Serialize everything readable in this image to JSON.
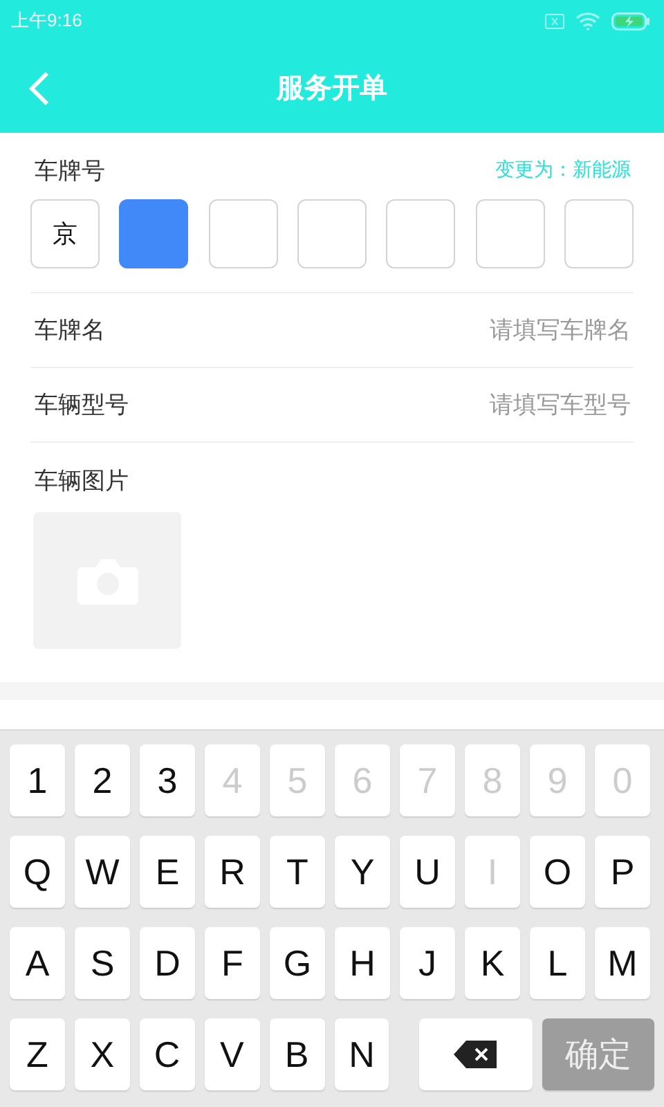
{
  "status_bar": {
    "time": "上午9:16"
  },
  "header": {
    "title": "服务开单"
  },
  "plate": {
    "label": "车牌号",
    "switch_link": "变更为：新能源",
    "cells": [
      {
        "value": "京",
        "selected": false
      },
      {
        "selected": true
      },
      {
        "selected": false
      },
      {
        "selected": false
      },
      {
        "selected": false
      },
      {
        "selected": false
      },
      {
        "selected": false
      }
    ]
  },
  "fields": [
    {
      "label": "车牌名",
      "placeholder": "请填写车牌名"
    },
    {
      "label": "车辆型号",
      "placeholder": "请填写车型号"
    }
  ],
  "photo": {
    "label": "车辆图片"
  },
  "keyboard": {
    "rows": [
      {
        "keys": [
          {
            "kind": "char",
            "label": "1",
            "disabled": false
          },
          {
            "kind": "char",
            "label": "2",
            "disabled": false
          },
          {
            "kind": "char",
            "label": "3",
            "disabled": false
          },
          {
            "kind": "char",
            "label": "4",
            "disabled": true
          },
          {
            "kind": "char",
            "label": "5",
            "disabled": true
          },
          {
            "kind": "char",
            "label": "6",
            "disabled": true
          },
          {
            "kind": "char",
            "label": "7",
            "disabled": true
          },
          {
            "kind": "char",
            "label": "8",
            "disabled": true
          },
          {
            "kind": "char",
            "label": "9",
            "disabled": true
          },
          {
            "kind": "char",
            "label": "0",
            "disabled": true
          }
        ]
      },
      {
        "keys": [
          {
            "kind": "char",
            "label": "Q",
            "disabled": false
          },
          {
            "kind": "char",
            "label": "W",
            "disabled": false
          },
          {
            "kind": "char",
            "label": "E",
            "disabled": false
          },
          {
            "kind": "char",
            "label": "R",
            "disabled": false
          },
          {
            "kind": "char",
            "label": "T",
            "disabled": false
          },
          {
            "kind": "char",
            "label": "Y",
            "disabled": false
          },
          {
            "kind": "char",
            "label": "U",
            "disabled": false
          },
          {
            "kind": "char",
            "label": "I",
            "disabled": true
          },
          {
            "kind": "char",
            "label": "O",
            "disabled": false
          },
          {
            "kind": "char",
            "label": "P",
            "disabled": false
          }
        ]
      },
      {
        "keys": [
          {
            "kind": "char",
            "label": "A",
            "disabled": false
          },
          {
            "kind": "char",
            "label": "S",
            "disabled": false
          },
          {
            "kind": "char",
            "label": "D",
            "disabled": false
          },
          {
            "kind": "char",
            "label": "F",
            "disabled": false
          },
          {
            "kind": "char",
            "label": "G",
            "disabled": false
          },
          {
            "kind": "char",
            "label": "H",
            "disabled": false
          },
          {
            "kind": "char",
            "label": "J",
            "disabled": false
          },
          {
            "kind": "char",
            "label": "K",
            "disabled": false
          },
          {
            "kind": "char",
            "label": "L",
            "disabled": false
          },
          {
            "kind": "char",
            "label": "M",
            "disabled": false
          }
        ]
      },
      {
        "keys": [
          {
            "kind": "char",
            "label": "Z",
            "disabled": false
          },
          {
            "kind": "char",
            "label": "X",
            "disabled": false
          },
          {
            "kind": "char",
            "label": "C",
            "disabled": false
          },
          {
            "kind": "char",
            "label": "V",
            "disabled": false
          },
          {
            "kind": "char",
            "label": "B",
            "disabled": false
          },
          {
            "kind": "char",
            "label": "N",
            "disabled": false
          },
          {
            "kind": "delete"
          },
          {
            "kind": "confirm",
            "label": "确定",
            "disabled": true
          }
        ]
      }
    ]
  }
}
